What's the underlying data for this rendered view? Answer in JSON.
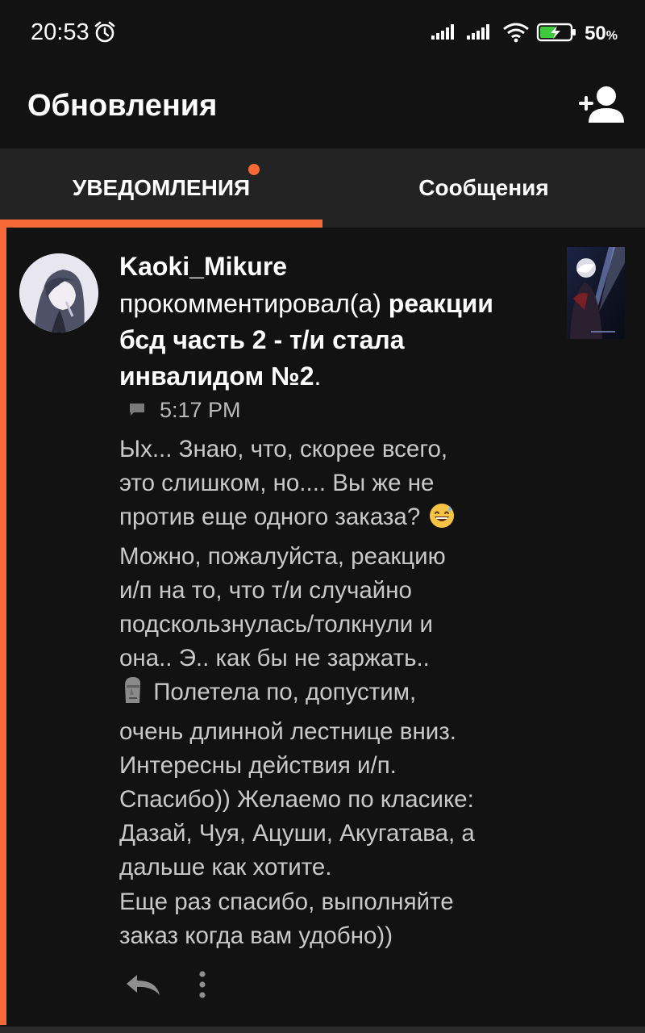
{
  "status_bar": {
    "time": "20:53",
    "battery_percent": "50",
    "battery_suffix": "%",
    "icons": [
      "alarm-icon",
      "signal-icon",
      "signal-icon",
      "wifi-icon",
      "battery-charging-icon"
    ]
  },
  "app_bar": {
    "title": "Обновления",
    "add_user_icon": "add-user-icon"
  },
  "tabs": [
    {
      "label": "УВЕДОМЛЕНИЯ",
      "active": true,
      "has_badge": true
    },
    {
      "label": "Сообщения",
      "active": false,
      "has_badge": false
    }
  ],
  "notification": {
    "username": "Kaoki_Mikure",
    "action": "прокомментировал(а)",
    "post_title_line1": "реакции",
    "post_title_line2": "бсд часть 2 - т/и стала",
    "post_title_line3": "инвалидом №2",
    "post_title_end": ".",
    "time": "5:17 PM",
    "comment_lines": [
      "Ых... Знаю, что, скорее всего,",
      "это слишком, но.... Вы же не",
      "против еще одного заказа?",
      "Можно, пожалуйста, реакцию",
      "и/п на то, что т/и случайно",
      "подскользнулась/толкнули и",
      "она.. Э.. как бы не заржать..",
      "Полетела по, допустим,",
      "очень длинной лестнице вниз.",
      "Интересны действия и/п.",
      "Спасибо)) Желаемо по класике:",
      "Дазай, Чуя, Ацуши, Акугатава, а",
      "дальше как хотите.",
      "Еще раз спасибо, выполняйте",
      "заказ когда вам удобно))"
    ]
  },
  "colors": {
    "accent": "#f76a38",
    "background": "#121212",
    "tab_bar": "#232323",
    "comment_text": "#c9c9c9"
  }
}
